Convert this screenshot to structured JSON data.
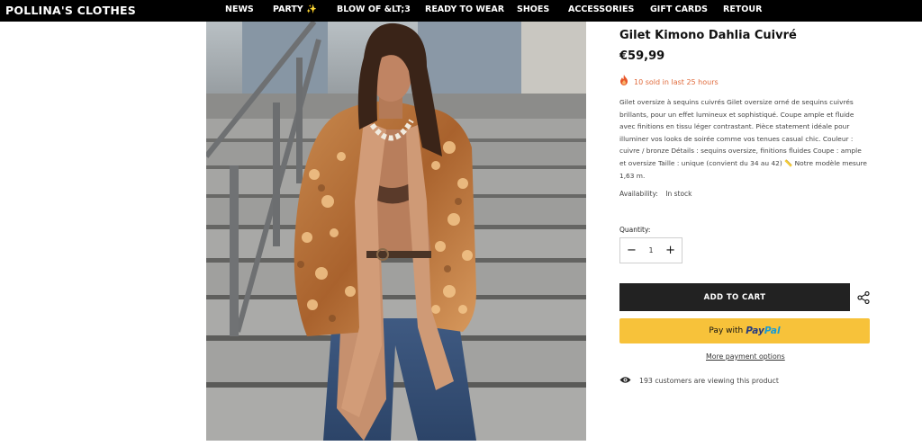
{
  "header": {
    "logo": "POLLINA'S CLOTHES",
    "nav": [
      {
        "label": "NEWS"
      },
      {
        "label": "PARTY ✨"
      },
      {
        "label": "BLOW OF &LT;3"
      },
      {
        "label": "READY TO WEAR"
      },
      {
        "label": "SHOES"
      },
      {
        "label": "ACCESSORIES"
      },
      {
        "label": "GIFT CARDS"
      },
      {
        "label": "RETOUR"
      }
    ]
  },
  "product": {
    "title": "Gilet Kimono Dahlia Cuivré",
    "price": "€59,99",
    "sold_notice": "10 sold in last 25 hours",
    "description": "  Gilet oversize à sequins cuivrés Gilet oversize orné de sequins cuivrés brillants, pour un effet lumineux et sophistiqué. Coupe ample et fluide avec finitions en tissu léger contrastant. Pièce statement idéale pour illuminer vos looks de soirée comme vos tenues casual chic. Couleur : cuivre / bronze Détails : sequins oversize, finitions fluides Coupe : ample et oversize Taille : unique (convient du 34 au 42) 📏 Notre modèle mesure 1,63 m.",
    "availability_label": "Availability:",
    "availability_value": "In stock",
    "quantity_label": "Quantity:",
    "quantity_value": "1",
    "quantity_minus": "−",
    "quantity_plus": "+",
    "add_to_cart": "ADD TO CART",
    "paypal_with": "Pay with",
    "paypal_pay": "Pay",
    "paypal_pal": "Pal",
    "more_payment": "More payment options",
    "viewers": "193 customers are viewing this product"
  },
  "icons": {
    "fire": "fire-icon",
    "share": "share-icon",
    "eye": "eye-icon"
  },
  "colors": {
    "topbar": "#000000",
    "add_to_cart_bg": "#222222",
    "paypal_bg": "#f7c23a",
    "sold_text": "#e06a3b"
  }
}
